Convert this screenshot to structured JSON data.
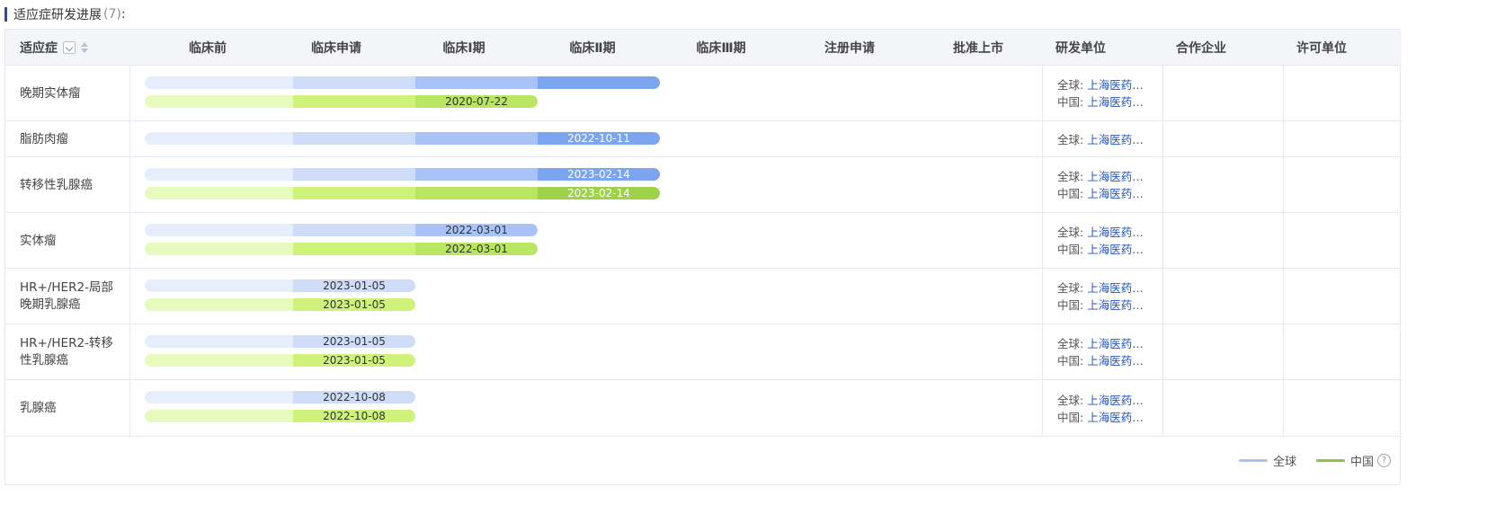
{
  "section": {
    "title": "适应症研发进展",
    "count": "(7)",
    "suffix": ":"
  },
  "header": {
    "indication": "适应症",
    "phases": [
      "临床前",
      "临床申请",
      "临床Ⅰ期",
      "临床Ⅱ期",
      "临床Ⅲ期",
      "注册申请",
      "批准上市"
    ],
    "rd_unit": "研发单位",
    "partner": "合作企业",
    "licensor": "许可单位"
  },
  "rows": [
    {
      "name_lines": [
        "晚期实体瘤",
        ""
      ],
      "tracks": [
        {
          "type": "global",
          "phase_reached": 4,
          "date": ""
        },
        {
          "type": "china",
          "phase_reached": 3,
          "date": "2020-07-22"
        }
      ],
      "orgs": [
        {
          "label": "全球:",
          "value": "上海医药…"
        },
        {
          "label": "中国:",
          "value": "上海医药…"
        }
      ]
    },
    {
      "name_lines": [
        "脂肪肉瘤",
        ""
      ],
      "tracks": [
        {
          "type": "global",
          "phase_reached": 4,
          "date": "2022-10-11"
        }
      ],
      "orgs": [
        {
          "label": "全球:",
          "value": "上海医药…"
        }
      ]
    },
    {
      "name_lines": [
        "转移性乳腺癌",
        ""
      ],
      "tracks": [
        {
          "type": "global",
          "phase_reached": 4,
          "date": "2023-02-14"
        },
        {
          "type": "china",
          "phase_reached": 4,
          "date": "2023-02-14"
        }
      ],
      "orgs": [
        {
          "label": "全球:",
          "value": "上海医药…"
        },
        {
          "label": "中国:",
          "value": "上海医药…"
        }
      ]
    },
    {
      "name_lines": [
        "实体瘤",
        ""
      ],
      "tracks": [
        {
          "type": "global",
          "phase_reached": 3,
          "date": "2022-03-01"
        },
        {
          "type": "china",
          "phase_reached": 3,
          "date": "2022-03-01"
        }
      ],
      "orgs": [
        {
          "label": "全球:",
          "value": "上海医药…"
        },
        {
          "label": "中国:",
          "value": "上海医药…"
        }
      ]
    },
    {
      "name_lines": [
        "HR+/HER2-局部",
        "晚期乳腺癌"
      ],
      "tracks": [
        {
          "type": "global",
          "phase_reached": 2,
          "date": "2023-01-05"
        },
        {
          "type": "china",
          "phase_reached": 2,
          "date": "2023-01-05"
        }
      ],
      "orgs": [
        {
          "label": "全球:",
          "value": "上海医药…"
        },
        {
          "label": "中国:",
          "value": "上海医药…"
        }
      ]
    },
    {
      "name_lines": [
        "HR+/HER2-转移",
        "性乳腺癌"
      ],
      "tracks": [
        {
          "type": "global",
          "phase_reached": 2,
          "date": "2023-01-05"
        },
        {
          "type": "china",
          "phase_reached": 2,
          "date": "2023-01-05"
        }
      ],
      "orgs": [
        {
          "label": "全球:",
          "value": "上海医药…"
        },
        {
          "label": "中国:",
          "value": "上海医药…"
        }
      ]
    },
    {
      "name_lines": [
        "乳腺癌",
        ""
      ],
      "tracks": [
        {
          "type": "global",
          "phase_reached": 2,
          "date": "2022-10-08"
        },
        {
          "type": "china",
          "phase_reached": 2,
          "date": "2022-10-08"
        }
      ],
      "orgs": [
        {
          "label": "全球:",
          "value": "上海医药…"
        },
        {
          "label": "中国:",
          "value": "上海医药…"
        }
      ]
    }
  ],
  "legend": {
    "global_label": "全球",
    "china_label": "中国",
    "global_color": "#a9c3f6",
    "china_color": "#8cc63f"
  },
  "colors": {
    "accent": "#1f4fb6",
    "link": "#2356c4"
  }
}
